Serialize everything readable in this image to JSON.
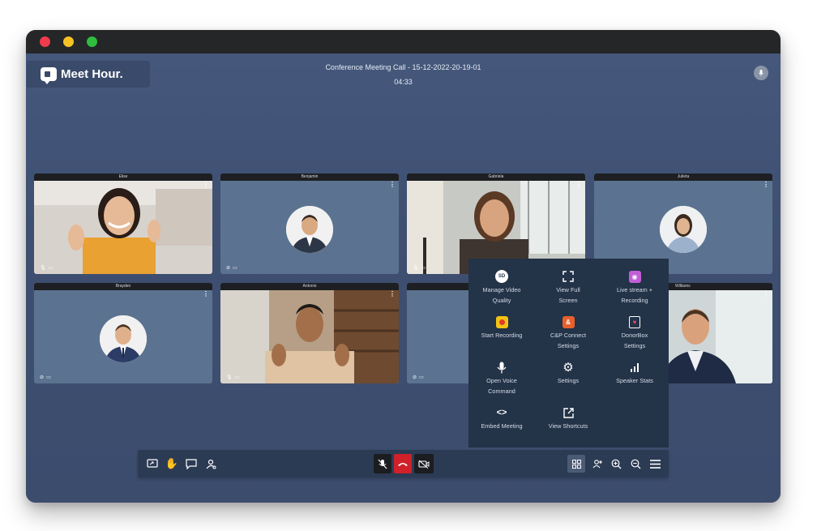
{
  "app": {
    "brand": "Meet Hour.",
    "meeting_title": "Conference Meeting Call - 15-12-2022-20-19-01",
    "timer": "04:33"
  },
  "participants": [
    {
      "name": "Elise"
    },
    {
      "name": "Benjamin"
    },
    {
      "name": "Gabriela"
    },
    {
      "name": "Julieta"
    },
    {
      "name": "Brayden"
    },
    {
      "name": "Antonio"
    },
    {
      "name": "Williams"
    }
  ],
  "more_menu": {
    "items": [
      {
        "label_1": "Manage Video",
        "label_2": "Quality",
        "icon": "sd-icon"
      },
      {
        "label_1": "View Full",
        "label_2": "Screen",
        "icon": "fullscreen-icon"
      },
      {
        "label_1": "Live stream +",
        "label_2": "Recording",
        "icon": "live-stream-icon"
      },
      {
        "label_1": "Start Recording",
        "label_2": "",
        "icon": "record-icon"
      },
      {
        "label_1": "C&P Connect",
        "label_2": "Settings",
        "icon": "cp-connect-icon"
      },
      {
        "label_1": "DonorBox",
        "label_2": "Settings",
        "icon": "donorbox-icon"
      },
      {
        "label_1": "Open Voice",
        "label_2": "Command",
        "icon": "microphone-icon"
      },
      {
        "label_1": "Settings",
        "label_2": "",
        "icon": "gear-icon"
      },
      {
        "label_1": "Speaker Stats",
        "label_2": "",
        "icon": "bar-chart-icon"
      },
      {
        "label_1": "Embed Meeting",
        "label_2": "",
        "icon": "code-icon"
      },
      {
        "label_1": "View Shortcuts",
        "label_2": "",
        "icon": "external-link-icon"
      }
    ],
    "badge_sd": "SD"
  },
  "colors": {
    "background": "#3f5072",
    "toolbar": "#2c3b54",
    "hangup": "#d0202a",
    "popup": "#233348",
    "tile": "#5b7391"
  }
}
